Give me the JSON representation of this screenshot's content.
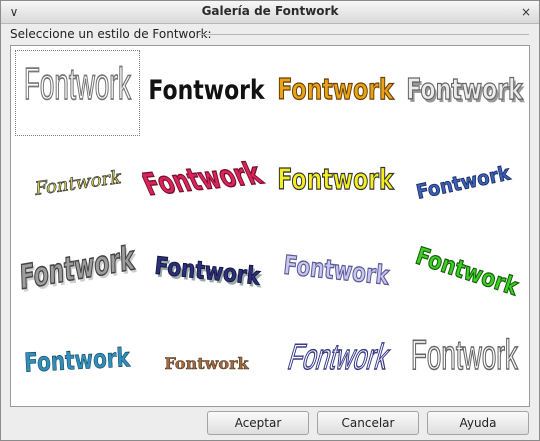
{
  "window": {
    "title": "Galería de Fontwork",
    "menu_glyph": "∨",
    "close_glyph": "×"
  },
  "prompt": "Seleccione un estilo de Fontwork:",
  "gallery": {
    "items": [
      {
        "text": "Fontwork",
        "style": "outline-gray-tall"
      },
      {
        "text": "Fontwork",
        "style": "black-arch"
      },
      {
        "text": "Fontwork",
        "style": "orange-gold"
      },
      {
        "text": "Fontwork",
        "style": "silver-shadow"
      },
      {
        "text": "Fontwork",
        "style": "yellow-italic-slant"
      },
      {
        "text": "Fontwork",
        "style": "red-perspective"
      },
      {
        "text": "Fontwork",
        "style": "yellow-bold"
      },
      {
        "text": "Fontwork",
        "style": "blue-slant-up"
      },
      {
        "text": "Fontwork",
        "style": "gray-3d"
      },
      {
        "text": "Fontwork",
        "style": "navy-3d"
      },
      {
        "text": "Fontwork",
        "style": "lavender-wave"
      },
      {
        "text": "Fontwork",
        "style": "green-arc"
      },
      {
        "text": "Fontwork",
        "style": "teal-wave"
      },
      {
        "text": "Fontwork",
        "style": "brown-arch"
      },
      {
        "text": "Fontwork",
        "style": "outline-slant"
      },
      {
        "text": "Fontwork",
        "style": "outline-tall"
      }
    ]
  },
  "buttons": {
    "ok": "Aceptar",
    "cancel": "Cancelar",
    "help": "Ayuda"
  }
}
